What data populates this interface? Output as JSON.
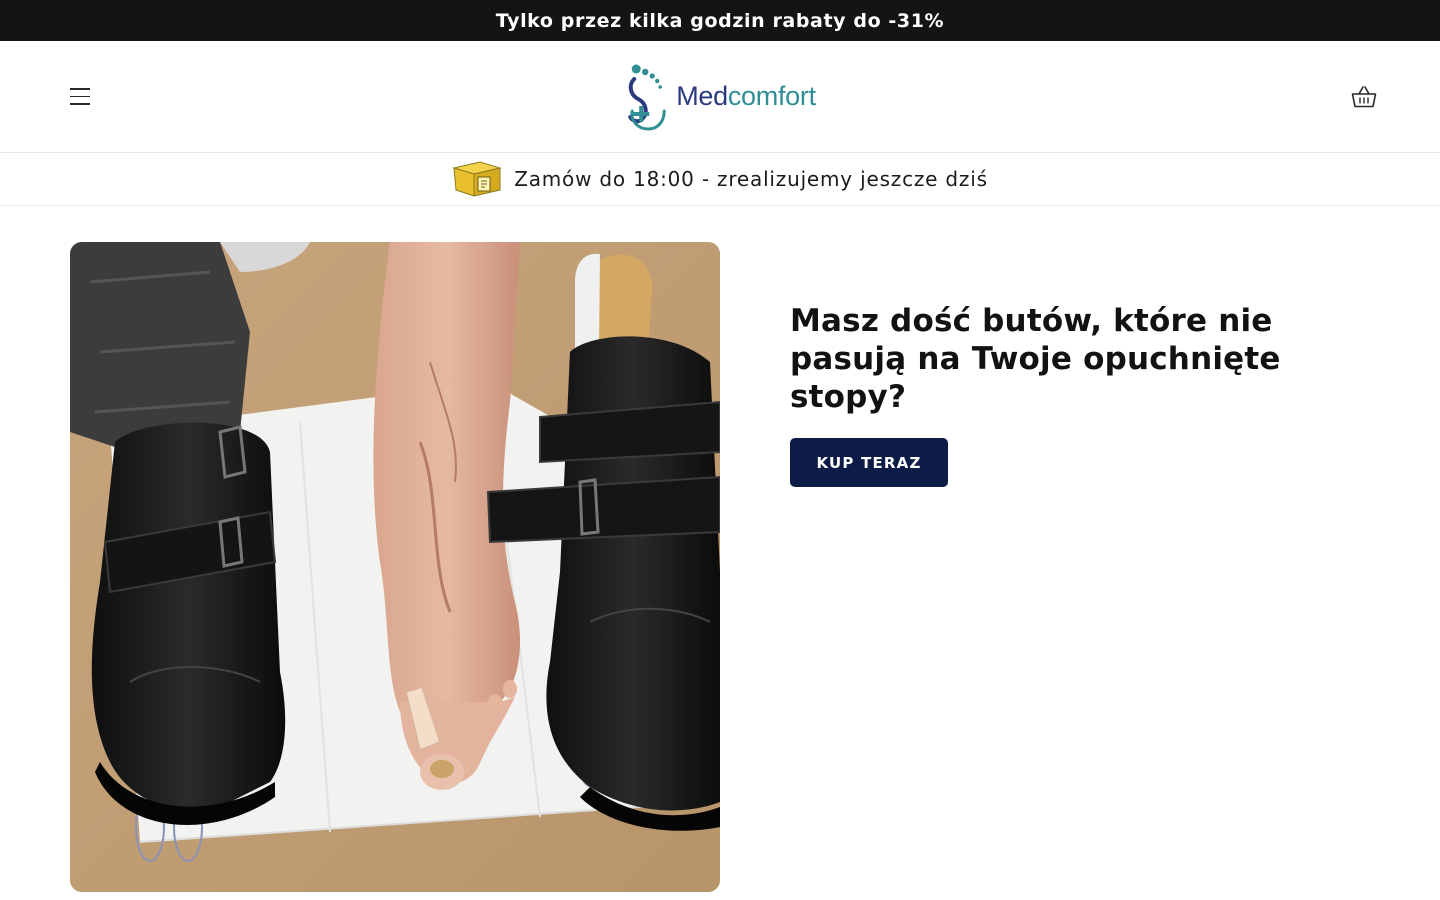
{
  "announcement": {
    "text": "Tylko przez kilka godzin rabaty do -31%"
  },
  "header": {
    "menu_icon": "hamburger-menu-icon",
    "logo": {
      "part1": "Med",
      "part2": "comfort",
      "icon": "foot-cross-logo-icon"
    },
    "cart_icon": "basket-icon"
  },
  "delivery": {
    "icon": "delivery-box-icon",
    "text": "Zamów do 18:00 - zrealizujemy jeszcze dziś"
  },
  "hero": {
    "title": "Masz dość butów, które nie pasują na Twoje opuchnięte stopy?",
    "button": "KUP TERAZ"
  },
  "colors": {
    "announcement_bg": "#141414",
    "button_bg": "#0c1c47",
    "logo_blue": "#2b3a7e",
    "logo_teal": "#2f8f94"
  }
}
